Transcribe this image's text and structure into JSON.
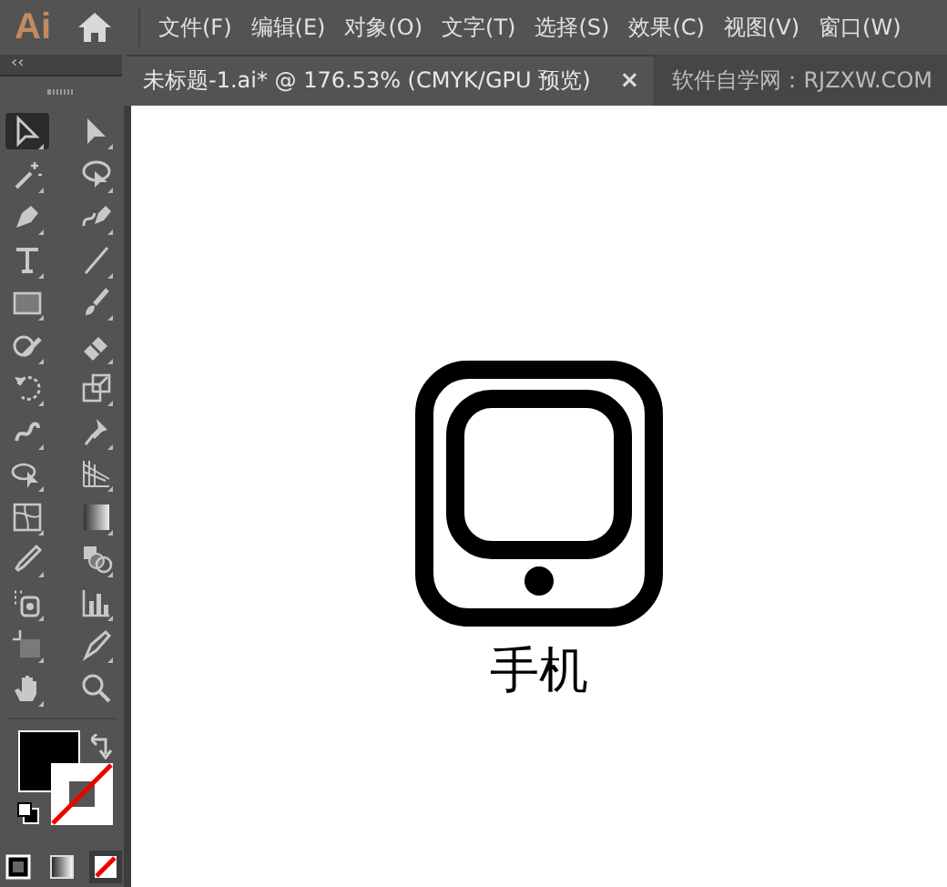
{
  "app": {
    "logo": "Ai"
  },
  "menu": [
    {
      "label": "文件(F)"
    },
    {
      "label": "编辑(E)"
    },
    {
      "label": "对象(O)"
    },
    {
      "label": "文字(T)"
    },
    {
      "label": "选择(S)"
    },
    {
      "label": "效果(C)"
    },
    {
      "label": "视图(V)"
    },
    {
      "label": "窗口(W)"
    }
  ],
  "panel_toggle": "‹‹",
  "tabs": [
    {
      "label": "未标题-1.ai* @ 176.53% (CMYK/GPU 预览)",
      "selected": true,
      "close": "×"
    },
    {
      "label": "软件自学网：RJZXW.COM",
      "selected": false
    }
  ],
  "tools": [
    {
      "selected": true
    },
    {
      "selected": false
    },
    {
      "selected": false
    },
    {
      "selected": false
    },
    {
      "selected": false
    },
    {
      "selected": false
    },
    {
      "selected": false
    },
    {
      "selected": false
    },
    {
      "selected": false
    },
    {
      "selected": false
    },
    {
      "selected": false
    },
    {
      "selected": false
    },
    {
      "selected": false
    },
    {
      "selected": false
    },
    {
      "selected": false
    },
    {
      "selected": false
    },
    {
      "selected": false
    },
    {
      "selected": false
    },
    {
      "selected": false
    },
    {
      "selected": false
    },
    {
      "selected": false
    },
    {
      "selected": false
    },
    {
      "selected": false
    },
    {
      "selected": false
    },
    {
      "selected": false
    },
    {
      "selected": false
    },
    {
      "selected": false
    },
    {
      "selected": false
    }
  ],
  "draw_modes": [
    {
      "kind": "color",
      "selected": false
    },
    {
      "kind": "gradient",
      "selected": false
    },
    {
      "kind": "none",
      "selected": true
    }
  ],
  "artboard": {
    "caption": "手机"
  }
}
